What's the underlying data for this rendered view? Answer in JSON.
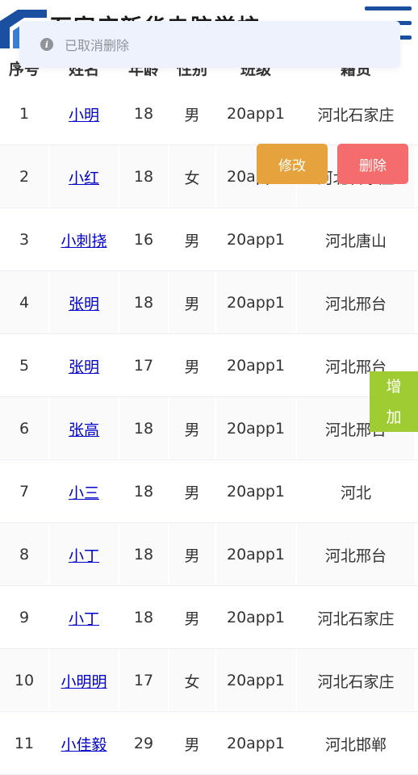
{
  "header": {
    "site_title": "石家庄新华电脑学校",
    "menu_icon": "hamburger-menu-icon"
  },
  "toast": {
    "icon": "info-icon",
    "icon_glyph": "i",
    "message": "已取消删除"
  },
  "table": {
    "columns": [
      "序号",
      "姓名",
      "年龄",
      "性别",
      "班级",
      "籍贯"
    ],
    "rows": [
      {
        "id": "1",
        "name": "小明",
        "age": "18",
        "gender": "男",
        "class": "20app1",
        "hometown": "河北石家庄"
      },
      {
        "id": "2",
        "name": "小红",
        "age": "18",
        "gender": "女",
        "class": "20app1",
        "hometown": "河北石家庄"
      },
      {
        "id": "3",
        "name": "小刺挠",
        "age": "16",
        "gender": "男",
        "class": "20app1",
        "hometown": "河北唐山"
      },
      {
        "id": "4",
        "name": "张明",
        "age": "18",
        "gender": "男",
        "class": "20app1",
        "hometown": "河北邢台"
      },
      {
        "id": "5",
        "name": "张明",
        "age": "17",
        "gender": "男",
        "class": "20app1",
        "hometown": "河北邢台"
      },
      {
        "id": "6",
        "name": "张高",
        "age": "18",
        "gender": "男",
        "class": "20app1",
        "hometown": "河北邢台"
      },
      {
        "id": "7",
        "name": "小三",
        "age": "18",
        "gender": "男",
        "class": "20app1",
        "hometown": "河北"
      },
      {
        "id": "8",
        "name": "小丁",
        "age": "18",
        "gender": "男",
        "class": "20app1",
        "hometown": "河北邢台"
      },
      {
        "id": "9",
        "name": "小丁",
        "age": "18",
        "gender": "男",
        "class": "20app1",
        "hometown": "河北石家庄"
      },
      {
        "id": "10",
        "name": "小明明",
        "age": "17",
        "gender": "女",
        "class": "20app1",
        "hometown": "河北石家庄"
      },
      {
        "id": "11",
        "name": "小佳毅",
        "age": "29",
        "gender": "男",
        "class": "20app1",
        "hometown": "河北邯郸"
      }
    ]
  },
  "actions": {
    "edit_label": "修改",
    "delete_label": "删除",
    "add_label_1": "增",
    "add_label_2": "加"
  },
  "colors": {
    "edit": "#e6a23c",
    "delete": "#f56c6c",
    "add": "#a0cc33",
    "toast_bg": "#edf2fc",
    "link": "#0000cc",
    "brand": "#1b4fa0"
  }
}
